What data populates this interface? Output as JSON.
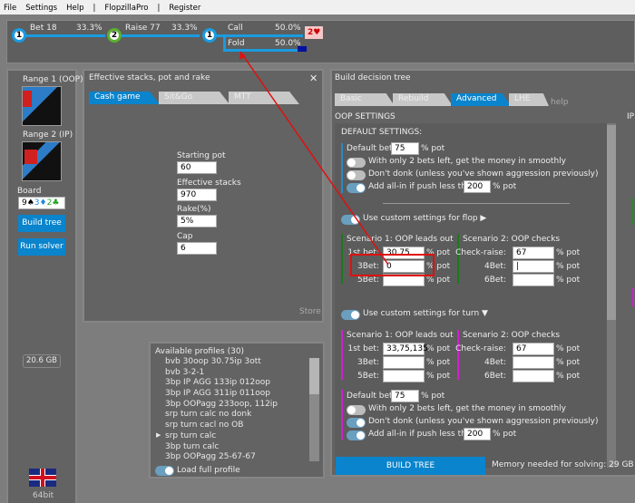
{
  "menu": [
    "File",
    "Settings",
    "Help",
    "|",
    "FlopzillaPro",
    "|",
    "Register"
  ],
  "tree": {
    "nodes": [
      "1",
      "2",
      "1"
    ],
    "actions": [
      {
        "label": "Bet 18",
        "pct": "33.3%"
      },
      {
        "label": "Raise 77",
        "pct": "33.3%"
      },
      {
        "label": "Call",
        "pct": "50.0%"
      },
      {
        "label": "Fold",
        "pct": "50.0%"
      }
    ],
    "card": "2♥"
  },
  "left": {
    "range1": "Range 1 (OOP)",
    "range2": "Range 2 (IP)",
    "board_label": "Board",
    "board": [
      "9♠",
      "3♦",
      "2♣"
    ],
    "build_tree": "Build tree",
    "run_solver": "Run solver",
    "memory": "20.6 GB",
    "bits": "64bit"
  },
  "stacks": {
    "title": "Effective stacks, pot and rake",
    "tabs": [
      "Cash game",
      "Sit&Go",
      "MTT"
    ],
    "close": "✕",
    "starting_pot_label": "Starting pot",
    "starting_pot": "60",
    "eff_label": "Effective stacks",
    "eff": "970",
    "rake_label": "Rake(%)",
    "rake": "5%",
    "cap_label": "Cap",
    "cap": "6",
    "store": "Store"
  },
  "profiles": {
    "title": "Available profiles (30)",
    "items": [
      "bvb 30oop 30.75ip 3ott",
      "bvb 3-2-1",
      "3bp IP AGG 133ip 012oop",
      "3bp IP AGG 311ip 011oop",
      "3bp OOPagg 233oop, 112ip",
      "srp turn calc no donk",
      "srp turn cacl no OB",
      "srp turn calc",
      "3bp turn calc",
      "3bp OOPagg 25-67-67"
    ],
    "selected": 7,
    "load_full": "Load full profile"
  },
  "build": {
    "title": "Build decision tree",
    "tabs": [
      "Basic",
      "Rebuild",
      "Advanced",
      "LHE"
    ],
    "help": "help",
    "oop": "OOP SETTINGS",
    "ip": "IP",
    "default_settings": "DEFAULT SETTINGS:",
    "default_bet_label": "Default bet:",
    "pot": "% pot",
    "default_bet": "75",
    "smooth": "With only 2 bets left, get the money in smoothly",
    "donk": "Don't donk (unless you've shown aggression previously)",
    "allin": "Add all-in if push less than",
    "allin_val": "200",
    "flop_custom": "Use custom settings for flop ▶",
    "turn_custom": "Use custom settings for turn ▼",
    "s1": "Scenario 1: OOP leads out",
    "s2": "Scenario 2: OOP checks",
    "first_bet": "1st bet:",
    "bet3": "3Bet:",
    "bet5": "5Bet:",
    "checkraise": "Check-raise:",
    "bet4": "4Bet:",
    "bet6": "6Bet:",
    "flop": {
      "first": "30,75",
      "bet3": "0",
      "bet5": "",
      "cr": "67",
      "bet4": "|",
      "bet6": ""
    },
    "turn": {
      "first": "33,75,135",
      "bet3": "",
      "bet5": "",
      "cr": "67",
      "bet4": "",
      "bet6": "",
      "default_bet": "75",
      "allin_val": "200"
    },
    "build_button": "BUILD TREE",
    "memory": "Memory needed for solving: 29 GB"
  },
  "colors": {
    "accent": "#0a84cc",
    "annotation": "#e01010"
  }
}
